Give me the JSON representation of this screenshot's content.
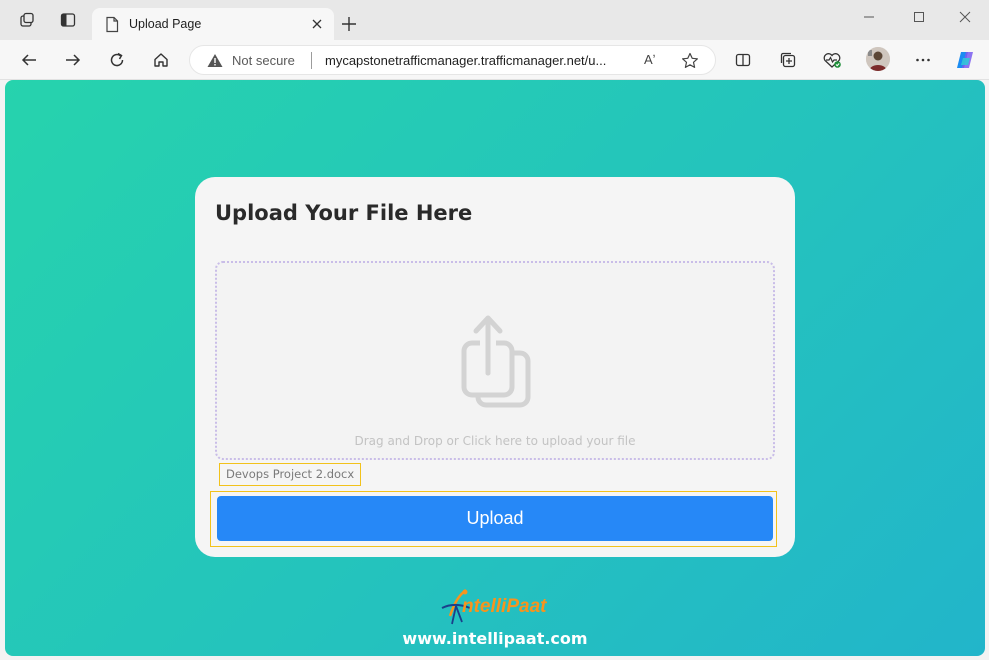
{
  "browser": {
    "tab_title": "Upload Page",
    "security_label": "Not secure",
    "url": "mycapstonetrafficmanager.trafficmanager.net/u...",
    "read_aloud_glyph": "Aʼ"
  },
  "page": {
    "card_title": "Upload Your File Here",
    "drop_text": "Drag and Drop or Click here to upload your file",
    "selected_file": "Devops Project 2.docx",
    "upload_button": "Upload",
    "footer_url": "www.intellipaat.com",
    "logo_text": "ntelliPaat"
  },
  "colors": {
    "gradient_start": "#26d3ad",
    "gradient_end": "#22b5ca",
    "button": "#2688f7",
    "highlight_outline": "#f2c21b",
    "logo_orange": "#f7941d"
  }
}
